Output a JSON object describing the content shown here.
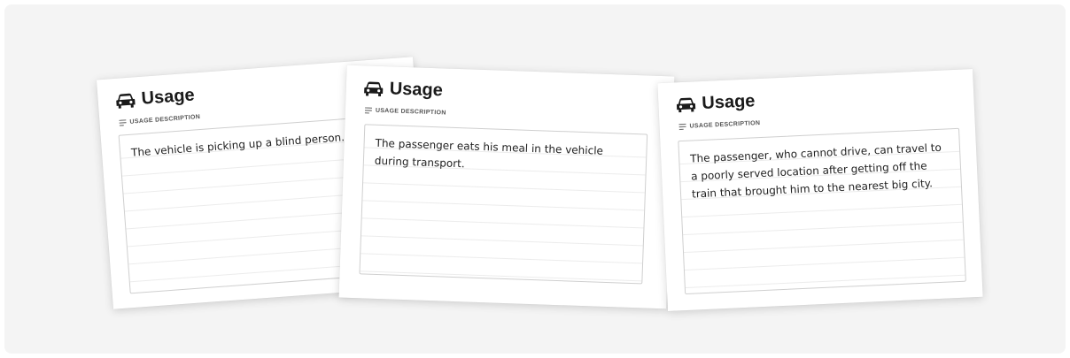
{
  "cards": [
    {
      "title": "Usage",
      "subtitle": "USAGE DESCRIPTION",
      "text": "The vehicle is picking up a blind person.",
      "title_icon": "car-icon",
      "subtitle_icon": "lines-icon"
    },
    {
      "title": "Usage",
      "subtitle": "USAGE DESCRIPTION",
      "text": "The passenger eats his meal in the vehicle during transport.",
      "title_icon": "car-icon",
      "subtitle_icon": "lines-icon"
    },
    {
      "title": "Usage",
      "subtitle": "USAGE DESCRIPTION",
      "text": "The passenger, who cannot drive, can travel to a poorly served location after getting off the train that brought him to the nearest big city.",
      "title_icon": "car-icon",
      "subtitle_icon": "lines-icon"
    }
  ],
  "colors": {
    "background": "#f4f4f4",
    "card": "#ffffff",
    "text": "#1e1e1e"
  }
}
